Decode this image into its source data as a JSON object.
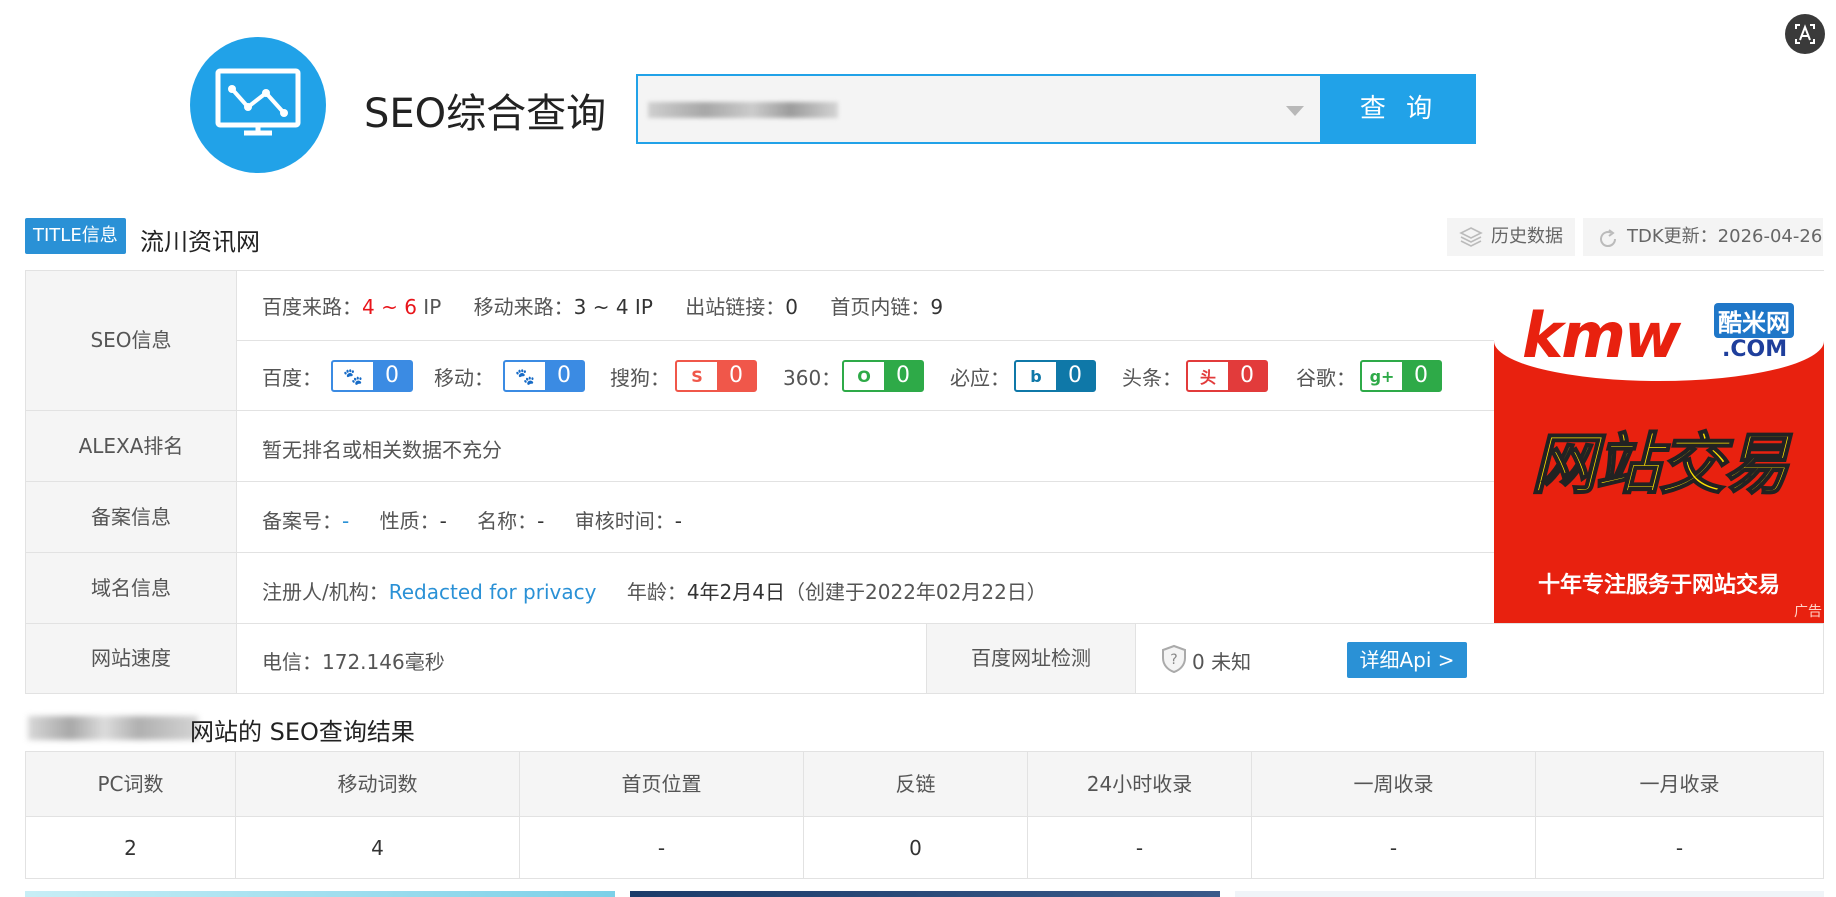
{
  "header": {
    "site_title": "SEO综合查询",
    "search_button": "查 询",
    "logo_icon": "chart-monitor-icon"
  },
  "title_row": {
    "badge": "TITLE信息",
    "title": "流川资讯网",
    "history_label": "历史数据",
    "tdk_label": "TDK更新：2026-04-26"
  },
  "seo_info": {
    "label": "SEO信息",
    "baidu_traffic_label": "百度来路：",
    "baidu_traffic_low": "4",
    "baidu_traffic_sep": " ~ ",
    "baidu_traffic_high": "6",
    "baidu_traffic_unit": " IP",
    "mobile_traffic_label": "移动来路：",
    "mobile_traffic_value": "3 ~ 4 IP",
    "outbound_label": "出站链接：",
    "outbound_value": "0",
    "inner_label": "首页内链：",
    "inner_value": "9",
    "engines": [
      {
        "label": "百度：",
        "value": "0",
        "color": "#3b8be3",
        "icon": "baidu-paw-icon"
      },
      {
        "label": "移动：",
        "value": "0",
        "color": "#3b8be3",
        "icon": "mobile-paw-icon"
      },
      {
        "label": "搜狗：",
        "value": "0",
        "color": "#f0574a",
        "icon": "sogou-icon"
      },
      {
        "label": "360：",
        "value": "0",
        "color": "#2eaa48",
        "icon": "360-icon"
      },
      {
        "label": "必应：",
        "value": "0",
        "color": "#0f78a8",
        "icon": "bing-icon"
      },
      {
        "label": "头条：",
        "value": "0",
        "color": "#e23b3b",
        "icon": "toutiao-icon"
      },
      {
        "label": "谷歌：",
        "value": "0",
        "color": "#2eaa48",
        "icon": "google-plus-icon"
      }
    ]
  },
  "alexa": {
    "label": "ALEXA排名",
    "value": "暂无排名或相关数据不充分"
  },
  "icp": {
    "label": "备案信息",
    "number_label": "备案号：",
    "number_value": "-",
    "type_label": "性质：",
    "type_value": "-",
    "name_label": "名称：",
    "name_value": "-",
    "time_label": "审核时间：",
    "time_value": "-"
  },
  "domain": {
    "label": "域名信息",
    "registrant_label": "注册人/机构：",
    "registrant_value": "Redacted for privacy",
    "age_label": "年龄：",
    "age_value": "4年2月4日",
    "created_note": "（创建于2022年02月22日）"
  },
  "speed": {
    "label": "网站速度",
    "value": "电信：172.146毫秒",
    "baidu_check_label": "百度网址检测",
    "baidu_check_value": "0 未知",
    "detail_button": "详细Api >"
  },
  "ad": {
    "brand": "kmw",
    "brand_cn": "酷米网",
    "brand_com": ".COM",
    "headline": "网站交易",
    "slogan": "十年专注服务于网站交易",
    "tag": "广告"
  },
  "results": {
    "title_suffix": "网站的 SEO查询结果",
    "columns": [
      "PC词数",
      "移动词数",
      "首页位置",
      "反链",
      "24小时收录",
      "一周收录",
      "一月收录"
    ],
    "values": [
      "2",
      "4",
      "-",
      "0",
      "-",
      "-",
      "-"
    ]
  }
}
